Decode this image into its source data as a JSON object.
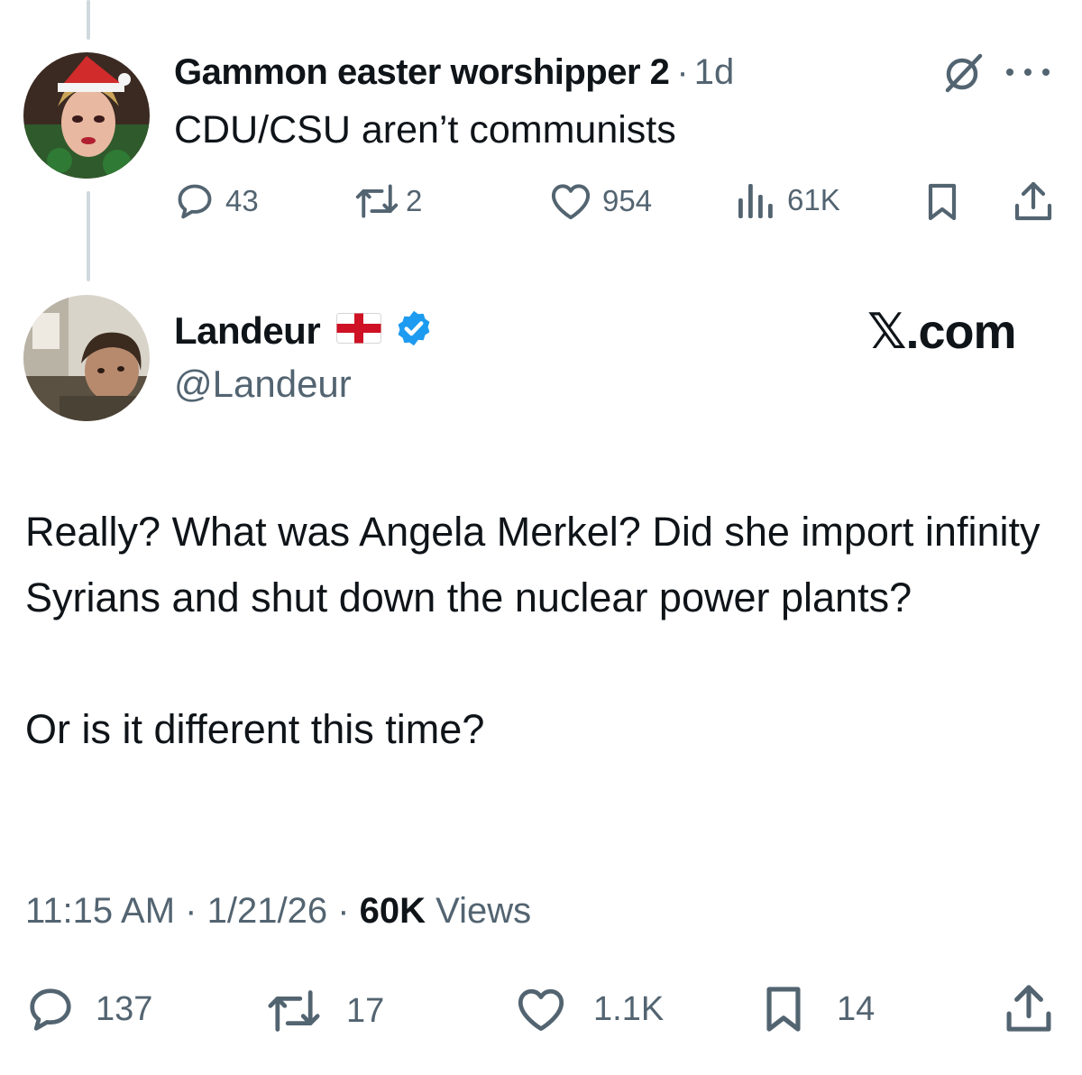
{
  "reply": {
    "display_name": "Gammon easter worshipper 2",
    "separator": "·",
    "time_ago": "1d",
    "text": "CDU/CSU aren’t communists",
    "actions": {
      "replies": "43",
      "reposts": "2",
      "likes": "954",
      "views": "61K"
    },
    "icons": [
      "grok-icon",
      "more-icon",
      "reply-icon",
      "repost-icon",
      "like-icon",
      "views-icon",
      "bookmark-icon",
      "share-icon"
    ]
  },
  "main": {
    "display_name": "Landeur",
    "flag": "england-flag",
    "verified": true,
    "handle": "@Landeur",
    "brand": "𝕏.com",
    "paragraphs": [
      "Really? What was Angela Merkel? Did she import infinity Syrians and shut down the nuclear power plants?",
      "Or is it different this time?"
    ],
    "meta": {
      "time": "11:15 AM",
      "date": "1/21/26",
      "views_count": "60K",
      "views_label": "Views"
    },
    "actions": {
      "replies": "137",
      "reposts": "17",
      "likes": "1.1K",
      "bookmarks": "14"
    }
  },
  "colors": {
    "text": "#0f1419",
    "secondary": "#536471",
    "verified": "#1d9bf0",
    "thread_line": "#cfd9de"
  }
}
